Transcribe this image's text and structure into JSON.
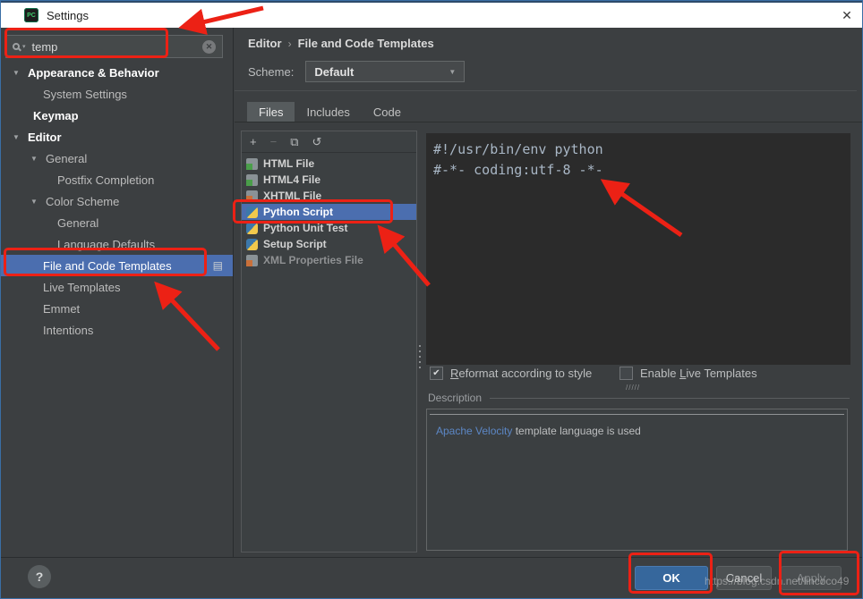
{
  "window": {
    "title": "Settings"
  },
  "icons": {
    "close": "✕",
    "search_clear": "✕",
    "expander": "▼",
    "dropdown_arrow": "▼",
    "breadcrumb_sep": "›",
    "selected_row_badge": "▤",
    "help": "?",
    "check": "✔",
    "toolbar_add": "+",
    "toolbar_remove": "−",
    "toolbar_copy": "⧉",
    "toolbar_reset": "↺",
    "hatch": "/////"
  },
  "sidebar": {
    "search_value": "temp",
    "tree": [
      {
        "label": "Appearance & Behavior"
      },
      {
        "label": "System Settings"
      },
      {
        "label": "Keymap"
      },
      {
        "label": "Editor"
      },
      {
        "label": "General"
      },
      {
        "label": "Postfix Completion"
      },
      {
        "label": "Color Scheme"
      },
      {
        "label": "General"
      },
      {
        "label": "Language Defaults"
      },
      {
        "label": "File and Code Templates"
      },
      {
        "label": "Live Templates"
      },
      {
        "label": "Emmet"
      },
      {
        "label": "Intentions"
      }
    ]
  },
  "header": {
    "crumb1": "Editor",
    "crumb2": "File and Code Templates",
    "scheme_label": "Scheme:",
    "scheme_value": "Default"
  },
  "tabs": {
    "files": "Files",
    "includes": "Includes",
    "code": "Code"
  },
  "file_list": {
    "items": [
      {
        "label": "HTML File"
      },
      {
        "label": "HTML4 File"
      },
      {
        "label": "XHTML File"
      },
      {
        "label": "Python Script"
      },
      {
        "label": "Python Unit Test"
      },
      {
        "label": "Setup Script"
      },
      {
        "label": "XML Properties File"
      }
    ]
  },
  "editor": {
    "line1": "#!/usr/bin/env python",
    "line2": "#-*- coding:utf-8 -*-"
  },
  "options": {
    "reformat_key": "R",
    "reformat_rest": "eformat according to style",
    "live_pre": "Enable ",
    "live_key": "L",
    "live_rest": "ive Templates"
  },
  "description": {
    "label": "Description",
    "link": "Apache Velocity",
    "text": " template language is used"
  },
  "footer": {
    "ok": "OK",
    "cancel": "Cancel",
    "apply": "Apply"
  },
  "watermark": "https://blog.csdn.net/lincoco49",
  "colors": {
    "selection": "#4b6eaf",
    "annotation": "#ec2115",
    "link": "#5c87c5",
    "ok_button": "#36679c",
    "editor_bg": "#2b2b2b",
    "panel_bg": "#3c3f41"
  }
}
